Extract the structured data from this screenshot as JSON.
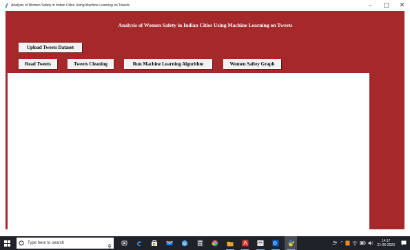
{
  "window": {
    "title": "Analysis of Women Safety in Indian Cities Using Machine Learning on Tweets",
    "minimize_glyph": "–",
    "maximize_glyph": "□",
    "close_glyph": "✕"
  },
  "app": {
    "heading": "Analysis of Women Safety in Indian Cities Using Machine Learning on Tweets",
    "background_color": "#a5282b",
    "buttons": {
      "upload": "Upload Tweets Dataset",
      "read": "Read Tweets",
      "cleaning": "Tweets Cleaning",
      "run_ml": "Run Machine Learning Algorithm",
      "graph": "Women Saftey Graph"
    },
    "output_text": ""
  },
  "taskbar": {
    "search_placeholder": "Type here to search",
    "pinned": [
      "task-view-icon",
      "edge-icon",
      "store-icon",
      "mail-icon",
      "photos-icon",
      "calculator-icon",
      "chrome-icon",
      "file-explorer-icon",
      "acrobat-icon",
      "paint-icon",
      "outlook-icon",
      "python-icon"
    ],
    "tray": {
      "show_hidden_glyph": "^",
      "clock_time": "14:17",
      "clock_date": "21-06-2020"
    }
  }
}
